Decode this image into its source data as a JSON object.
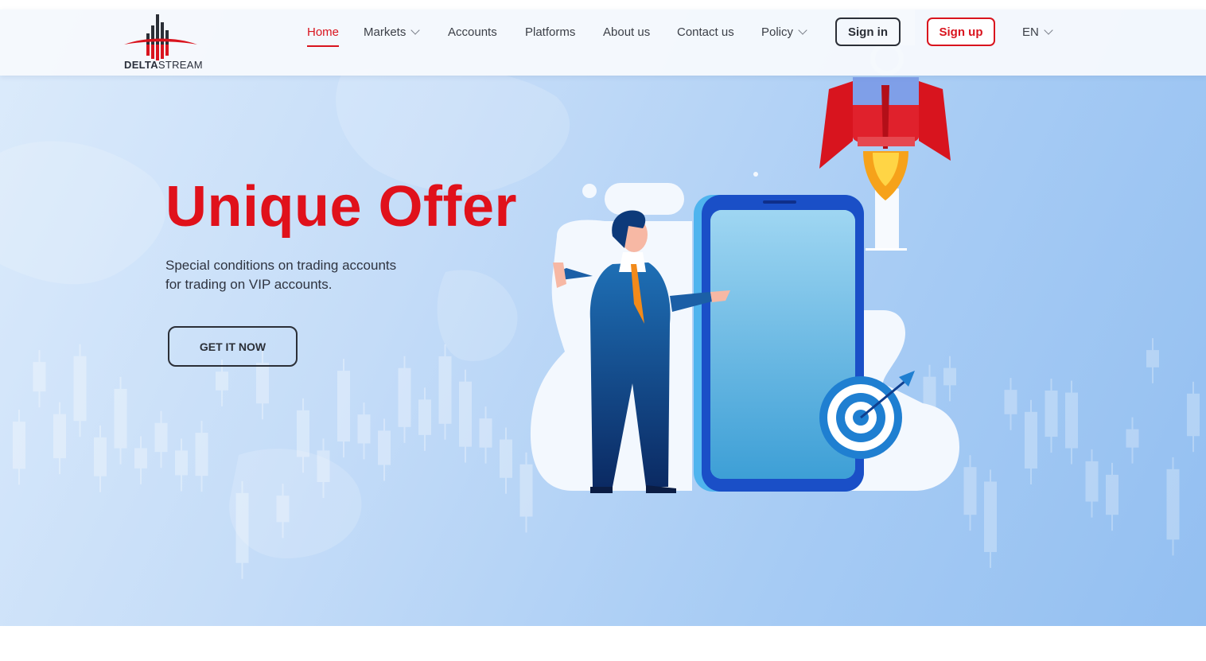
{
  "brand": {
    "name_bold": "DELTA",
    "name_rest": "STREAM",
    "accent_color": "#d9141e",
    "dark_color": "#2b2f37"
  },
  "nav": {
    "items": [
      {
        "label": "Home",
        "active": true,
        "dropdown": false
      },
      {
        "label": "Markets",
        "active": false,
        "dropdown": true
      },
      {
        "label": "Accounts",
        "active": false,
        "dropdown": false
      },
      {
        "label": "Platforms",
        "active": false,
        "dropdown": false
      },
      {
        "label": "About us",
        "active": false,
        "dropdown": false
      },
      {
        "label": "Contact us",
        "active": false,
        "dropdown": false
      },
      {
        "label": "Policy",
        "active": false,
        "dropdown": true
      }
    ],
    "signin_label": "Sign in",
    "signup_label": "Sign up",
    "language": "EN"
  },
  "hero": {
    "title": "Unique Offer",
    "subtitle_line1": "Special conditions on trading accounts",
    "subtitle_line2": "for trading on VIP accounts.",
    "cta_label": "GET IT NOW"
  },
  "icons": [
    "deltastream-logo-icon",
    "chevron-down-icon",
    "rocket-icon",
    "businessman-illustration",
    "smartphone-icon",
    "target-icon",
    "candlestick-chart-background"
  ]
}
